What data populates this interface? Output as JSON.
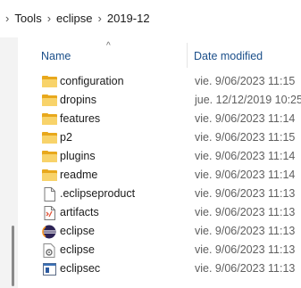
{
  "breadcrumb": {
    "separator": "›",
    "items": [
      "Tools",
      "eclipse",
      "2019-12"
    ]
  },
  "columns": {
    "name": "Name",
    "date": "Date modified",
    "sort_indicator": "^"
  },
  "files": [
    {
      "name": "configuration",
      "date": "vie. 9/06/2023 11:15",
      "icon": "folder-icon"
    },
    {
      "name": "dropins",
      "date": "jue. 12/12/2019 10:25",
      "icon": "folder-icon"
    },
    {
      "name": "features",
      "date": "vie. 9/06/2023 11:14",
      "icon": "folder-icon"
    },
    {
      "name": "p2",
      "date": "vie. 9/06/2023 11:15",
      "icon": "folder-icon"
    },
    {
      "name": "plugins",
      "date": "vie. 9/06/2023 11:14",
      "icon": "folder-icon"
    },
    {
      "name": "readme",
      "date": "vie. 9/06/2023 11:14",
      "icon": "folder-icon"
    },
    {
      "name": ".eclipseproduct",
      "date": "vie. 9/06/2023 11:13",
      "icon": "file-icon"
    },
    {
      "name": "artifacts",
      "date": "vie. 9/06/2023 11:13",
      "icon": "xml-file-icon"
    },
    {
      "name": "eclipse",
      "date": "vie. 9/06/2023 11:13",
      "icon": "eclipse-app-icon"
    },
    {
      "name": "eclipse",
      "date": "vie. 9/06/2023 11:13",
      "icon": "settings-file-icon"
    },
    {
      "name": "eclipsec",
      "date": "vie. 9/06/2023 11:13",
      "icon": "console-app-icon"
    }
  ]
}
